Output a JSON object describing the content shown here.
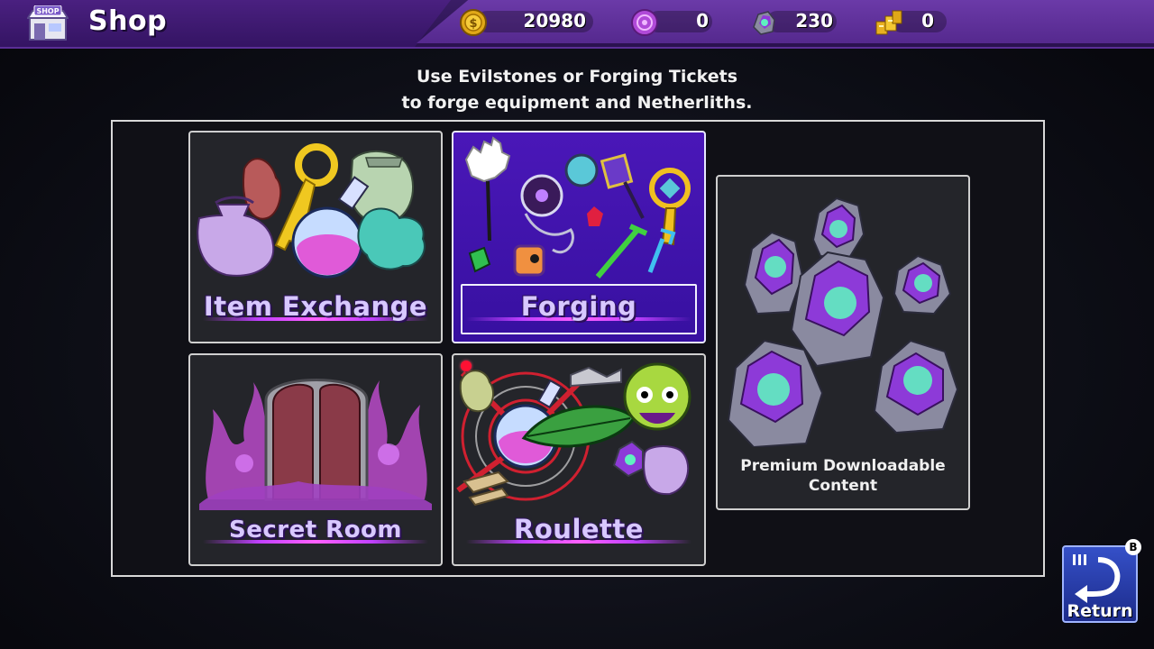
{
  "header": {
    "title": "Shop",
    "shop_icon_text": "SHOP",
    "currencies": [
      {
        "name": "gold-coin",
        "value": "20980"
      },
      {
        "name": "purple-medal",
        "value": "0"
      },
      {
        "name": "evilstone",
        "value": "230"
      },
      {
        "name": "forging-ticket",
        "value": "0"
      }
    ]
  },
  "instruction": {
    "line1": "Use Evilstones or Forging Tickets",
    "line2": "to forge equipment and Netherliths."
  },
  "menu": {
    "item_exchange": "Item Exchange",
    "forging": "Forging",
    "secret_room": "Secret Room",
    "roulette": "Roulette",
    "premium": "Premium Downloadable Content"
  },
  "return": {
    "label": "Return",
    "button_hint": "B"
  },
  "colors": {
    "accent": "#4a17b8",
    "header": "#55298e",
    "return": "#2a3eb0"
  }
}
